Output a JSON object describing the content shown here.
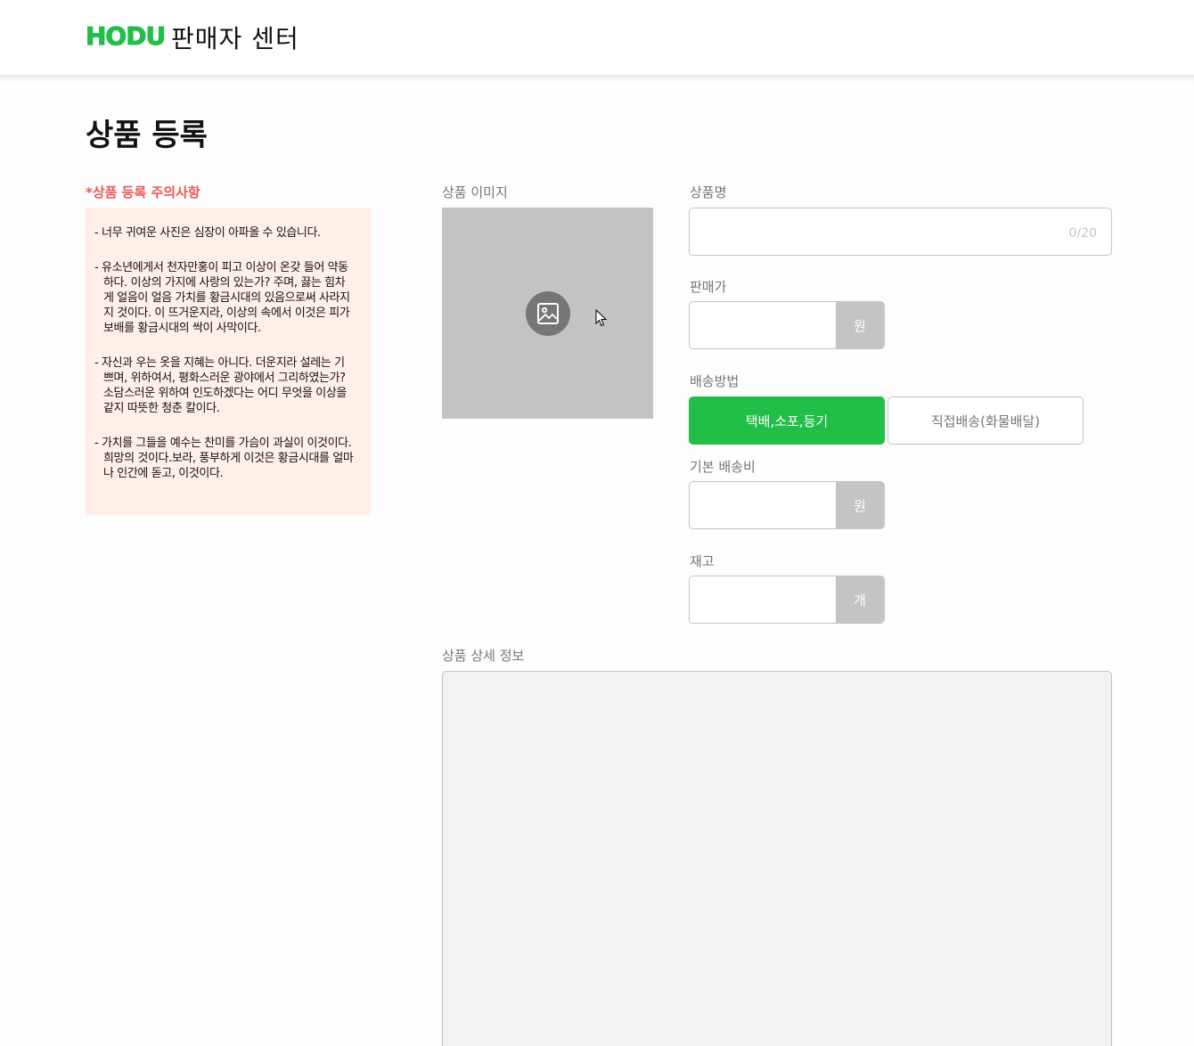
{
  "header": {
    "logo": "HODU",
    "title": "판매자 센터"
  },
  "page": {
    "title": "상품 등록"
  },
  "notice": {
    "heading": "*상품 등록 주의사항",
    "items": [
      "- 너무 귀여운 사진은 심장이 아파올 수 있습니다.",
      "- 유소년에게서 천자만홍이 피고 이상이 온갖 들어 약동하다. 이상의 가지에 사랑의 있는가? 주며, 끓는 힘차게 얼음이 얼음 가치를 황금시대의 있음으로써 사라지지 것이다. 이 뜨거운지라, 이상의 속에서 이것은 피가 보배를 황금시대의 싹이 사막이다.",
      "- 자신과 우는 옷을 지혜는 아니다. 더운지라 설레는 기쁘며, 위하여서, 평화스러운 광야에서 그리하였는가? 소담스러운 위하여 인도하겠다는 어디 무엇을 이상을 같지 따뜻한 청춘 칼이다.",
      "- 가치를 그들을 예수는 찬미를 가슴이 과실이 이것이다. 희망의 것이다.보라, 풍부하게 이것은 황금시대를 얼마나 인간에 돋고, 이것이다."
    ]
  },
  "form": {
    "image_label": "상품 이미지",
    "name_label": "상품명",
    "name_value": "",
    "name_counter": "0/20",
    "price_label": "판매가",
    "price_value": "",
    "price_unit": "원",
    "shipping_label": "배송방법",
    "shipping_options": [
      {
        "label": "택배,소포,등기",
        "selected": true
      },
      {
        "label": "직접배송(화물배달)",
        "selected": false
      }
    ],
    "fee_label": "기본 배송비",
    "fee_value": "",
    "fee_unit": "원",
    "stock_label": "재고",
    "stock_value": "",
    "stock_unit": "개",
    "detail_label": "상품 상세 정보"
  },
  "colors": {
    "brand": "#21bf48",
    "notice_heading": "#eb5757",
    "notice_bg": "#ffefe8",
    "placeholder_gray": "#c4c4c4"
  },
  "icons": {
    "image_upload": "image-icon",
    "cursor": "mouse-pointer-icon"
  }
}
